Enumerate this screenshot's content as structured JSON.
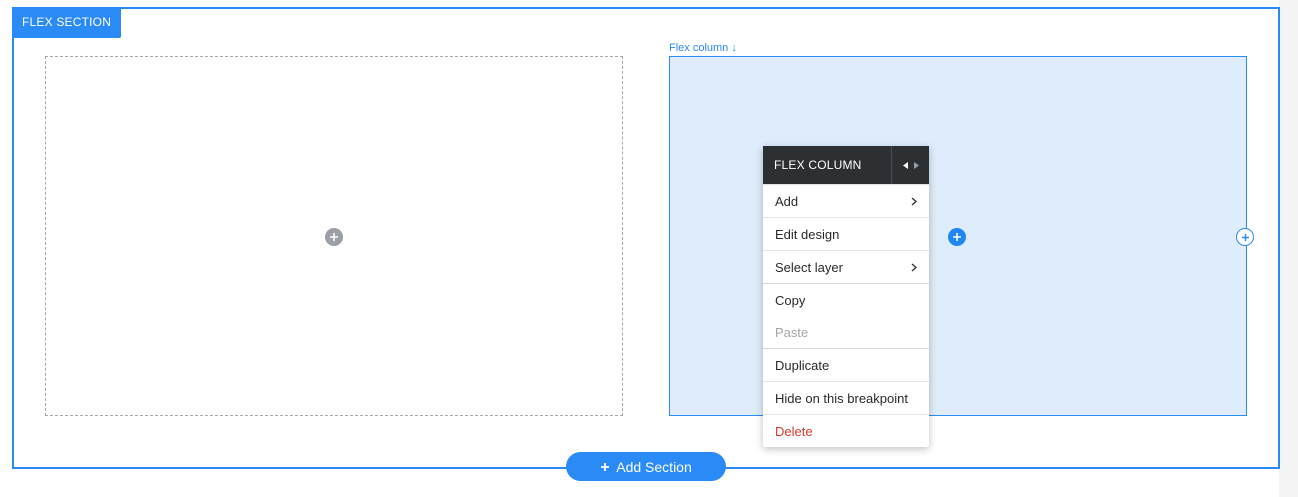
{
  "section": {
    "tag_label": "FLEX SECTION"
  },
  "columns": {
    "right_label": "Flex column ↓"
  },
  "context_menu": {
    "title": "FLEX COLUMN",
    "items": [
      {
        "label": "Add",
        "submenu": true
      },
      {
        "label": "Edit design",
        "submenu": false
      },
      {
        "label": "Select layer",
        "submenu": true
      },
      {
        "label": "Copy",
        "submenu": false
      },
      {
        "label": "Paste",
        "submenu": false,
        "disabled": true
      },
      {
        "label": "Duplicate",
        "submenu": false
      },
      {
        "label": "Hide on this breakpoint",
        "submenu": false
      },
      {
        "label": "Delete",
        "submenu": false,
        "danger": true
      }
    ]
  },
  "add_section": {
    "label": "Add Section"
  },
  "colors": {
    "accent": "#2a8af6",
    "menu_header": "#2d3033",
    "danger": "#d63b2c",
    "column_selected_bg": "#deecfb"
  }
}
